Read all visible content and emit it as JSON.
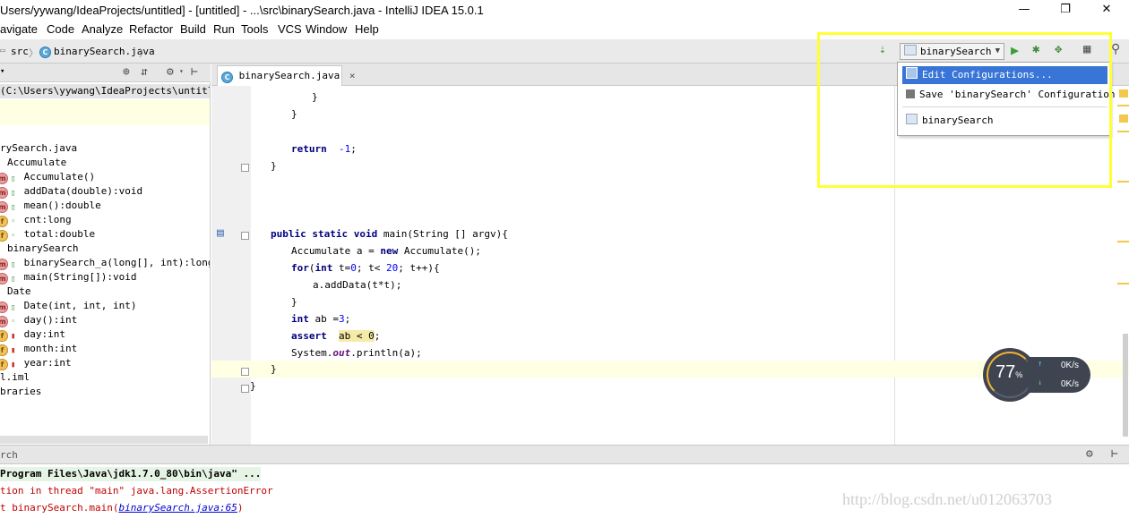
{
  "window": {
    "title": "Users/yywang/IdeaProjects/untitled] - [untitled] - ...\\src\\binarySearch.java - IntelliJ IDEA 15.0.1",
    "minimize_glyph": "—",
    "maximize_glyph": "❐",
    "close_glyph": "✕"
  },
  "menu": [
    "avigate",
    "Code",
    "Analyze",
    "Refactor",
    "Build",
    "Run",
    "Tools",
    "VCS",
    "Window",
    "Help"
  ],
  "breadcrumb": {
    "items": [
      "src",
      "binarySearch.java"
    ],
    "separator": "〉"
  },
  "project_panel": {
    "path": "(C:\\Users\\yywang\\IdeaProjects\\untitled)",
    "tree": [
      {
        "text": "rySearch.java",
        "indent": 0,
        "icon": ""
      },
      {
        "text": "Accumulate",
        "indent": 1,
        "icon": ""
      },
      {
        "text": "Accumulate()",
        "indent": 2,
        "icon": "m",
        "acc": "unlock"
      },
      {
        "text": "addData(double):void",
        "indent": 2,
        "icon": "m",
        "acc": "unlock"
      },
      {
        "text": "mean():double",
        "indent": 2,
        "icon": "m",
        "acc": "unlock"
      },
      {
        "text": "cnt:long",
        "indent": 2,
        "icon": "f",
        "acc": "dot"
      },
      {
        "text": "total:double",
        "indent": 2,
        "icon": "f",
        "acc": "dot"
      },
      {
        "text": "binarySearch",
        "indent": 1,
        "icon": ""
      },
      {
        "text": "binarySearch_a(long[], int):long",
        "indent": 2,
        "icon": "m",
        "acc": "unlock"
      },
      {
        "text": "main(String[]):void",
        "indent": 2,
        "icon": "m",
        "acc": "unlock"
      },
      {
        "text": "Date",
        "indent": 1,
        "icon": ""
      },
      {
        "text": "Date(int, int, int)",
        "indent": 2,
        "icon": "m",
        "acc": "unlock"
      },
      {
        "text": "day():int",
        "indent": 2,
        "icon": "m",
        "acc": "dot"
      },
      {
        "text": "day:int",
        "indent": 2,
        "icon": "f",
        "acc": "lock"
      },
      {
        "text": "month:int",
        "indent": 2,
        "icon": "f",
        "acc": "lock"
      },
      {
        "text": "year:int",
        "indent": 2,
        "icon": "f",
        "acc": "lock"
      },
      {
        "text": "l.iml",
        "indent": 0,
        "icon": ""
      },
      {
        "text": "braries",
        "indent": 0,
        "icon": ""
      }
    ]
  },
  "editor_tab": {
    "label": "binarySearch.java",
    "close": "×"
  },
  "code": {
    "brace1": "}",
    "brace2": "}",
    "return_kw": "return",
    "return_val": "-1",
    "return_end": ";",
    "brace3": "}",
    "main_kw": "public static void",
    "main_rest": " main(String [] argv){",
    "acc_line_a": "Accumulate a = ",
    "new_kw": "new",
    "acc_line_b": " Accumulate();",
    "for_kw": "for",
    "for_a": "(",
    "int_kw": "int",
    "for_b": " t=",
    "zero": "0",
    "for_c": "; t< ",
    "twenty": "20",
    "for_d": "; t++){",
    "adddata": "a.addData(t*t);",
    "brace4": "}",
    "int_kw2": "int",
    "ab_decl": " ab =",
    "three": "3",
    "semi": ";",
    "assert_kw": "assert",
    "assert_expr": "ab < 0",
    "println_a": "System.",
    "println_out": "out",
    "println_b": ".println(a);",
    "brace5": "}",
    "brace6": "}"
  },
  "run_config": {
    "name": "binarySearch",
    "menu_items": [
      {
        "label": "Edit Configurations...",
        "selected": true
      },
      {
        "label": "Save 'binarySearch' Configuration",
        "selected": false
      },
      {
        "label": "binarySearch",
        "selected": false
      }
    ]
  },
  "speed_widget": {
    "percent": "77",
    "percent_sign": "%",
    "up": "0K/s",
    "down": "0K/s"
  },
  "run_panel": {
    "title": "rch"
  },
  "console": {
    "line1": "Program Files\\Java\\jdk1.7.0_80\\bin\\java\" ...",
    "line2": "tion in thread \"main\" java.lang.AssertionError",
    "line3a": "t binarySearch.main(",
    "line3link": "binarySearch.java:65",
    "line3b": ")"
  },
  "watermark": "http://blog.csdn.net/u012063703",
  "colors": {
    "accent": "#3875d7",
    "highlight": "#ffff33",
    "keyword": "#000080",
    "number": "#0000ff",
    "console_error": "#c00000"
  }
}
